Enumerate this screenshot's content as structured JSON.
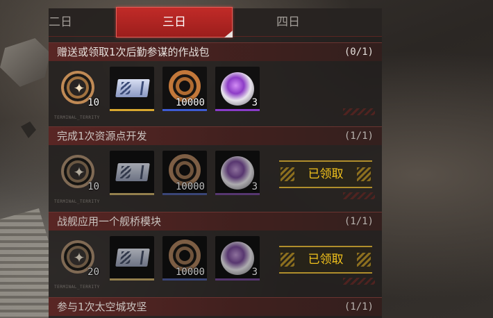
{
  "tabs": {
    "prev": "二日",
    "active": "三日",
    "next": "四日"
  },
  "tasks": [
    {
      "title": "赠送或领取1次后勤参谋的作战包",
      "progress": "(0/1)",
      "rewards": [
        "10",
        "",
        "10000",
        "3"
      ],
      "claimed_label": ""
    },
    {
      "title": "完成1次资源点开发",
      "progress": "(1/1)",
      "rewards": [
        "10",
        "",
        "10000",
        "3"
      ],
      "claimed_label": "已领取"
    },
    {
      "title": "战舰应用一个舰桥模块",
      "progress": "(1/1)",
      "rewards": [
        "20",
        "",
        "10000",
        "3"
      ],
      "claimed_label": "已领取"
    },
    {
      "title": "参与1次太空城攻坚",
      "progress": "(1/1)"
    }
  ],
  "icons": {
    "reward_1": "star-medal-icon",
    "reward_2": "ticket-icon",
    "reward_3": "coin-icon",
    "reward_4": "purple-orb-icon"
  },
  "colors": {
    "tab_active": "#b5302c",
    "claimed_text": "#f2c21c",
    "rarity_gold": "#d9a830",
    "rarity_blue": "#3f5bd3",
    "rarity_purple": "#8a3cc9"
  }
}
